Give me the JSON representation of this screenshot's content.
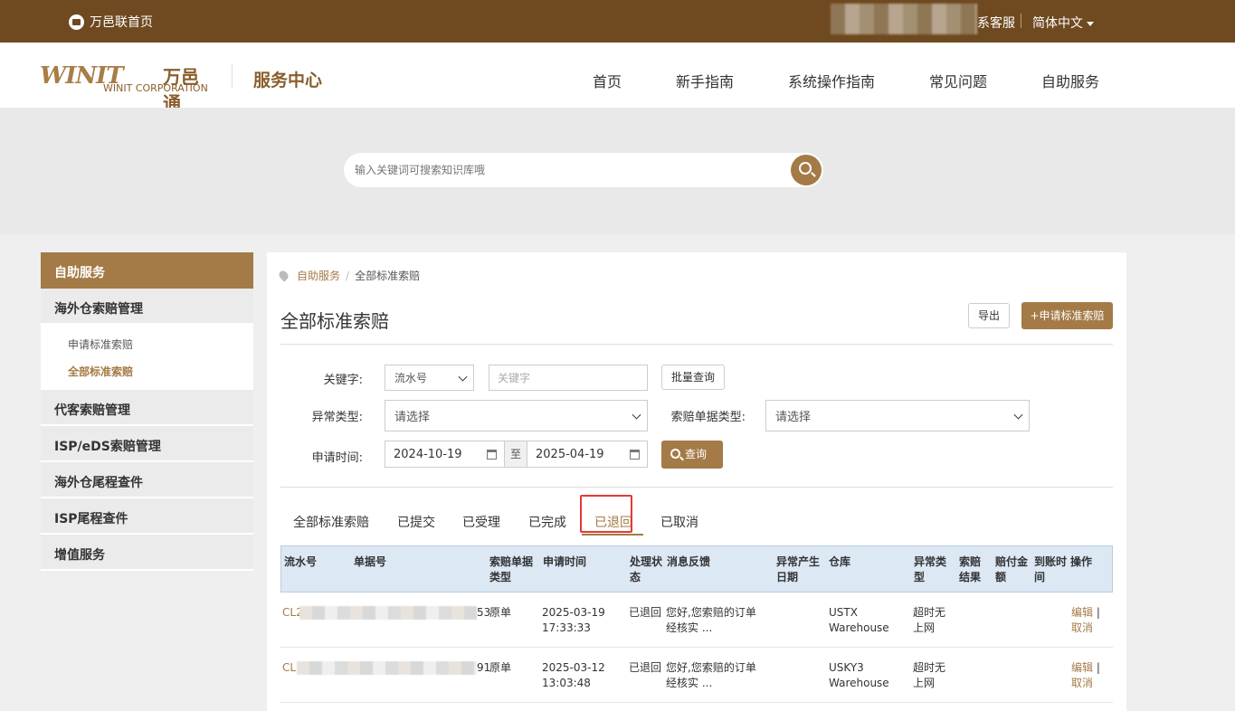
{
  "topbar": {
    "home": "万邑联首页",
    "service": "系客服",
    "lang": "简体中文"
  },
  "header": {
    "logo_wnit": "WINIT",
    "logo_cn": "万邑通",
    "logo_en": "WINIT CORPORATION",
    "title": "服务中心",
    "nav": [
      "首页",
      "新手指南",
      "系统操作指南",
      "常见问题",
      "自助服务"
    ]
  },
  "search": {
    "placeholder": "输入关键词可搜索知识库哦"
  },
  "sidebar": {
    "head": "自助服务",
    "groups": [
      "海外仓索赔管理",
      "代客索赔管理",
      "ISP/eDS索赔管理",
      "海外仓尾程查件",
      "ISP尾程查件",
      "增值服务"
    ],
    "sub": [
      "申请标准索赔",
      "全部标准索赔"
    ]
  },
  "breadcrumb": {
    "root": "自助服务",
    "sep": "/",
    "current": "全部标准索赔"
  },
  "page": {
    "title": "全部标准索赔",
    "export": "导出",
    "apply": "+申请标准索赔"
  },
  "filters": {
    "keyword_label": "关键字:",
    "keyword_type": "流水号",
    "keyword_placeholder": "关键字",
    "batch": "批量查询",
    "abnormal_label": "异常类型:",
    "abnormal_value": "请选择",
    "doc_label": "索赔单据类型:",
    "doc_value": "请选择",
    "date_label": "申请时间:",
    "date_from": "2024-10-19",
    "date_to_sep": "至",
    "date_to": "2025-04-19",
    "query": "查询"
  },
  "tabs": [
    "全部标准索赔",
    "已提交",
    "已受理",
    "已完成",
    "已退回",
    "已取消"
  ],
  "table": {
    "headers": [
      "流水号",
      "单据号",
      "索赔单据类型",
      "申请时间",
      "处理状态",
      "消息反馈",
      "异常产生日期",
      "仓库",
      "异常类型",
      "索赔结果",
      "赔付金额",
      "到账时间",
      "操作"
    ],
    "rows": [
      {
        "serial_prefix": "CL2",
        "serial_suffix": "53",
        "doc_type": "原单",
        "date": "2025-03-19",
        "time": "17:33:33",
        "status": "已退回",
        "msg1": "您好,您索赔的订单",
        "msg2": "经核实 ...",
        "wh1": "USTX",
        "wh2": "Warehouse",
        "abn1": "超时无",
        "abn2": "上网",
        "edit": "编辑",
        "cancel": "取消"
      },
      {
        "serial_prefix": "CL",
        "serial_suffix": "91",
        "doc_type": "原单",
        "date": "2025-03-12",
        "time": "13:03:48",
        "status": "已退回",
        "msg1": "您好,您索赔的订单",
        "msg2": "经核实 ...",
        "wh1": "USKY3",
        "wh2": "Warehouse",
        "abn1": "超时无",
        "abn2": "上网",
        "edit": "编辑",
        "cancel": "取消"
      }
    ]
  },
  "colors": {
    "brown": "#6f4a20",
    "accent": "#a47a46",
    "highlight": "#e53935"
  }
}
